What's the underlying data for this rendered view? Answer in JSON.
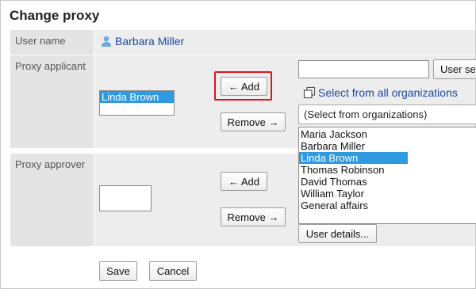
{
  "page": {
    "title": "Change proxy"
  },
  "rows": {
    "user_name_label": "User name",
    "proxy_applicant_label": "Proxy applicant",
    "proxy_approver_label": "Proxy approver"
  },
  "user": {
    "name": "Barbara Miller",
    "icon": "person-icon"
  },
  "applicant": {
    "list": [
      {
        "label": "Linda Brown",
        "selected": true
      }
    ],
    "add_label": "← Add",
    "remove_label": "Remove →"
  },
  "approver": {
    "add_label": "← Add",
    "remove_label": "Remove →"
  },
  "search": {
    "input_value": "",
    "button_label": "User se"
  },
  "org": {
    "link_label": "Select from all organizations",
    "icon": "windows-icon",
    "dropdown_value": "(Select from organizations)"
  },
  "candidates": [
    {
      "label": "Maria Jackson",
      "selected": false
    },
    {
      "label": "Barbara Miller",
      "selected": false
    },
    {
      "label": "Linda Brown",
      "selected": true
    },
    {
      "label": "Thomas Robinson",
      "selected": false
    },
    {
      "label": "David Thomas",
      "selected": false
    },
    {
      "label": "William Taylor",
      "selected": false
    },
    {
      "label": "General affairs",
      "selected": false
    }
  ],
  "user_details_label": "User details...",
  "footer": {
    "save_label": "Save",
    "cancel_label": "Cancel"
  },
  "colors": {
    "selection": "#2f9ae0",
    "link": "#1a4ba0",
    "highlight": "#e0141e"
  }
}
